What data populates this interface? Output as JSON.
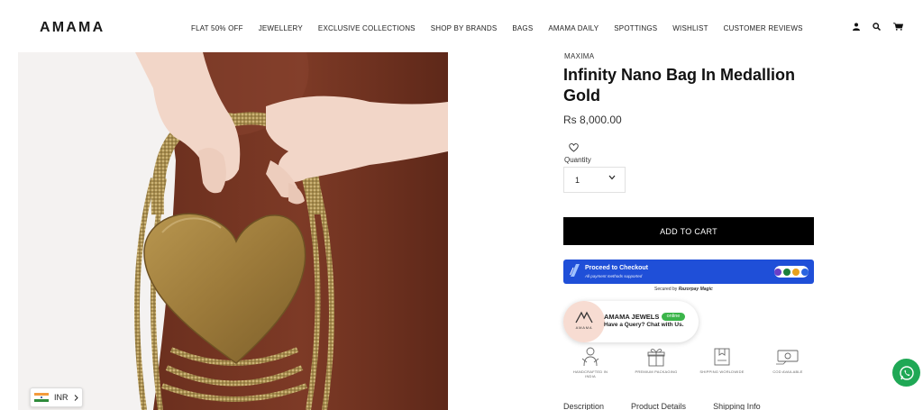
{
  "header": {
    "logo": "AMAMA",
    "nav": [
      "FLAT 50% OFF",
      "JEWELLERY",
      "EXCLUSIVE COLLECTIONS",
      "SHOP BY BRANDS",
      "BAGS",
      "AMAMA DAILY",
      "SPOTTINGS",
      "WISHLIST",
      "CUSTOMER REVIEWS"
    ],
    "icons": [
      "account-icon",
      "search-icon",
      "cart-icon"
    ]
  },
  "currency": {
    "code": "INR"
  },
  "product": {
    "vendor": "MAXIMA",
    "title": "Infinity Nano Bag In Medallion Gold",
    "price": "Rs 8,000.00",
    "quantity_label": "Quantity",
    "quantity_value": "1",
    "add_to_cart_label": "ADD TO CART"
  },
  "checkout": {
    "title": "Proceed to Checkout",
    "subtitle": "All payment methods supported",
    "secured_prefix": "Secured by",
    "secured_brand": "Razorpay Magic"
  },
  "chat": {
    "brand": "AMAMA",
    "name": "AMAMA JEWELS",
    "status": "online",
    "subtitle": "Have a Query? Chat with Us."
  },
  "features": [
    {
      "label": "HANDCRAFTED IN INDIA",
      "icon": "handcrafted-icon"
    },
    {
      "label": "PREMIUM PACKAGING",
      "icon": "gift-box-icon"
    },
    {
      "label": "SHIPPING WORLDWIDE",
      "icon": "shipping-box-icon"
    },
    {
      "label": "COD AVAILABLE",
      "icon": "cash-icon"
    }
  ],
  "tabs": [
    "Description",
    "Product Details",
    "Shipping Info"
  ],
  "colors": {
    "checkout_blue": "#1f4fd8",
    "whatsapp_green": "#1fa855",
    "online_green": "#3bb54a",
    "chat_avatar_bg": "#f7dcd2"
  }
}
